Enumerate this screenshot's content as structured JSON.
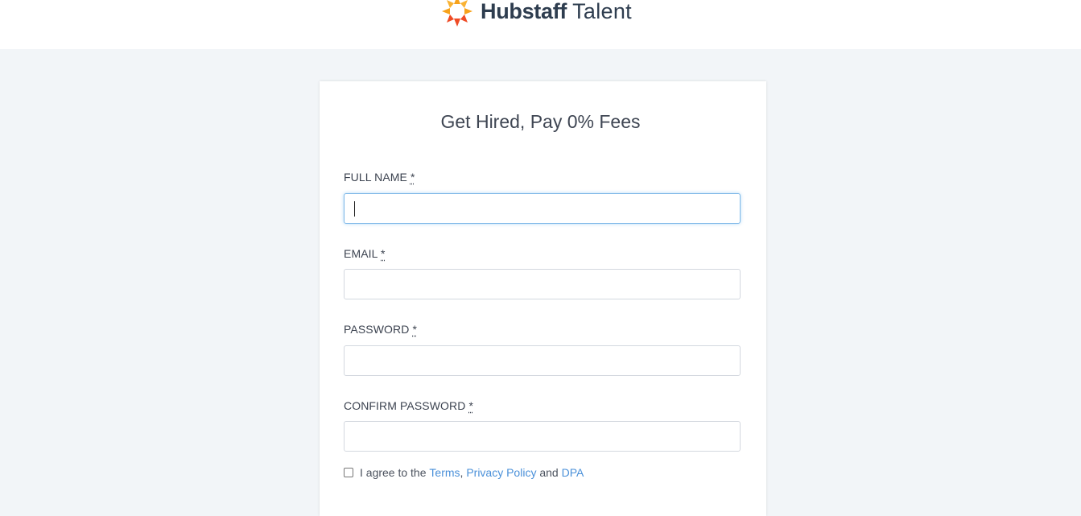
{
  "header": {
    "brand_bold": "Hubstaff",
    "brand_light": "Talent",
    "logo_icon": "hubstaff-sun-icon"
  },
  "form": {
    "title": "Get Hired, Pay 0% Fees",
    "fields": [
      {
        "label": "FULL NAME",
        "required_mark": "*",
        "value": "",
        "focused": true
      },
      {
        "label": "EMAIL",
        "required_mark": "*",
        "value": ""
      },
      {
        "label": "PASSWORD",
        "required_mark": "*",
        "value": ""
      },
      {
        "label": "CONFIRM PASSWORD",
        "required_mark": "*",
        "value": ""
      }
    ],
    "agree": {
      "checked": false,
      "prefix": "I agree to the",
      "terms": "Terms",
      "comma": ",",
      "privacy": "Privacy Policy",
      "and": "and",
      "dpa": "DPA"
    }
  },
  "colors": {
    "page_bg": "#f2f5f8",
    "brand_text": "#2e3d4f",
    "link": "#4a90d9",
    "logo_orange": "#f7a21b",
    "logo_red": "#ef4b25"
  }
}
